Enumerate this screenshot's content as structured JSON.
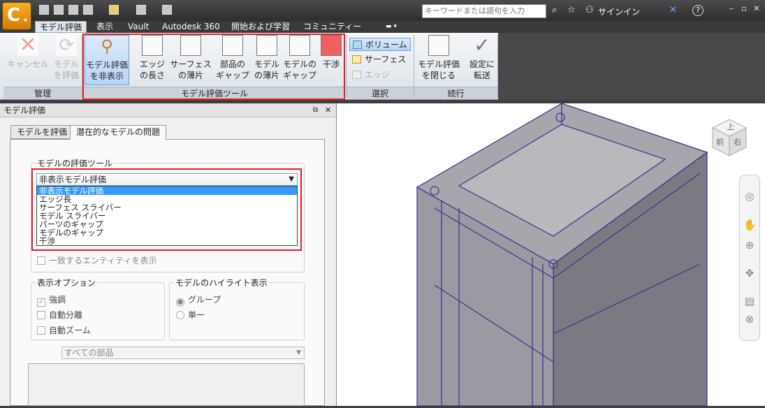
{
  "app": {
    "logo_letter": "C",
    "logo_dropdown": "▾"
  },
  "search": {
    "placeholder": "キーワードまたは語句を入力"
  },
  "header": {
    "signin_label": "サインイン",
    "help_label": "?"
  },
  "tabs": [
    {
      "label": "モデル評価",
      "active": true
    },
    {
      "label": "表示"
    },
    {
      "label": "Vault"
    },
    {
      "label": "Autodesk 360"
    },
    {
      "label": "開始および学習"
    },
    {
      "label": "コミュニティー"
    }
  ],
  "ribbon": {
    "buttons": [
      {
        "line1": "キャンセル",
        "line2": "",
        "disabled": true,
        "icon": "cancel-x-icon"
      },
      {
        "line1": "モデル",
        "line2": "を評価",
        "disabled": true,
        "icon": "refresh-icon"
      },
      {
        "line1": "モデル評価",
        "line2": "を非表示",
        "selected": true,
        "icon": "broom-icon"
      },
      {
        "line1": "エッジ",
        "line2": "の長さ",
        "icon": "edge-length-icon"
      },
      {
        "line1": "サーフェス",
        "line2": "の薄片",
        "icon": "surface-slice-icon"
      },
      {
        "line1": "部品の",
        "line2": "ギャップ",
        "icon": "part-gap-icon"
      },
      {
        "line1": "モデル",
        "line2": "の薄片",
        "icon": "model-slice-icon"
      },
      {
        "line1": "モデルの",
        "line2": "ギャップ",
        "icon": "model-gap-icon"
      },
      {
        "line1": "干渉",
        "line2": "",
        "icon": "interference-icon"
      },
      {
        "line1": "モデル評価",
        "line2": "を閉じる",
        "icon": "close-evaluation-icon"
      },
      {
        "line1": "設定に",
        "line2": "転送",
        "icon": "checkmark-icon"
      }
    ],
    "selection": [
      {
        "label": "ボリューム",
        "selected": true
      },
      {
        "label": "サーフェス"
      },
      {
        "label": "エッジ",
        "disabled": true
      }
    ],
    "groups": [
      "管理",
      "モデル評価ツール",
      "選択",
      "続行"
    ]
  },
  "panel": {
    "title": "モデル評価",
    "tabs": [
      "モデルを評価",
      "潜在的なモデルの問題"
    ],
    "tool_legend": "モデルの評価ツール",
    "combo_value": "非表示モデル評価",
    "dropdown_options": [
      "非表示モデル評価",
      "エッジ長",
      "サーフェス スライバー",
      "モデル スライバー",
      "パーツのギャップ",
      "モデルのギャップ",
      "干渉"
    ],
    "match_entities": "一致するエンティティを表示",
    "display_options_legend": "表示オプション",
    "display_options": [
      {
        "label": "強調",
        "checked": true
      },
      {
        "label": "自動分離",
        "checked": false
      },
      {
        "label": "自動ズーム",
        "checked": false
      }
    ],
    "highlight_legend": "モデルのハイライト表示",
    "highlight_options": [
      {
        "label": "グループ",
        "selected": true
      },
      {
        "label": "単一",
        "selected": false
      }
    ],
    "parts_select": "すべての部品"
  },
  "viewcube": {
    "top": "上",
    "front": "前",
    "right": "右"
  },
  "colors": {
    "accent_red": "#e2202a",
    "selection_blue": "#3399ff",
    "model_purple": "#3b2f8f"
  }
}
